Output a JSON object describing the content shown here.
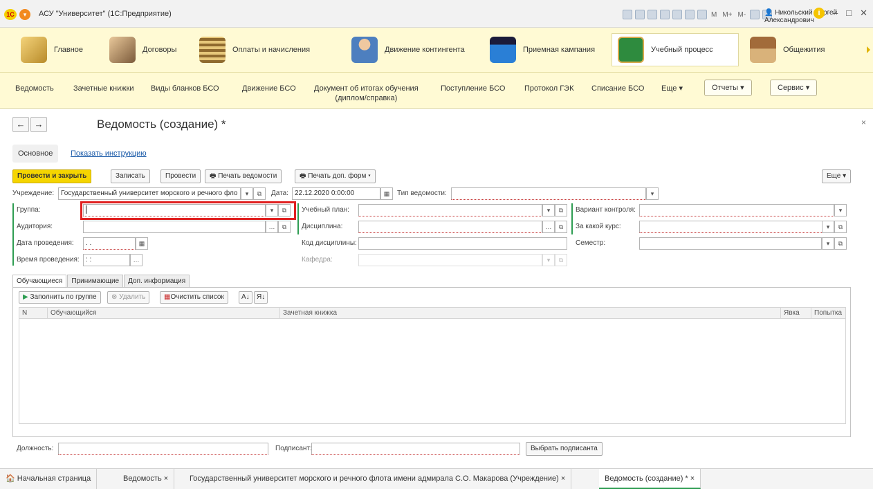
{
  "window": {
    "title": "АСУ \"Университет\" (1С:Предприятие)",
    "logo_text": "1С",
    "user": "Никольский Сергей Александрович",
    "toolbar_text": [
      "M",
      "M+",
      "M-"
    ],
    "info_label": "i",
    "minimize": "–",
    "maximize": "□",
    "close": "✕"
  },
  "sections": [
    {
      "label": "Главное",
      "icon": "desk-lamp-icon",
      "color": "#d8b14a"
    },
    {
      "label": "Договоры",
      "icon": "handshake-icon",
      "color": "#c8a06a"
    },
    {
      "label": "Оплаты и начисления",
      "icon": "abacus-icon",
      "color": "#8f6a2e"
    },
    {
      "label": "Движение контингента",
      "icon": "person-icon",
      "color": "#4d7fbf"
    },
    {
      "label": "Приемная кампания",
      "icon": "graduate-icon",
      "color": "#2a7fd6"
    },
    {
      "label": "Учебный процесс",
      "icon": "blackboard-icon",
      "color": "#2e8b3e"
    },
    {
      "label": "Общежития",
      "icon": "house-icon",
      "color": "#8b5a2b"
    }
  ],
  "subnav": {
    "items": [
      "Ведомость",
      "Зачетные книжки",
      "Виды бланков БСО",
      "Движение БСО",
      "Документ об итогах обучения",
      "Поступление БСО",
      "Протокол ГЭК",
      "Списание БСО"
    ],
    "item_doc_line2": "(диплом/справка)",
    "more": "Еще ▾",
    "reports": "Отчеты ▾",
    "service": "Сервис ▾"
  },
  "form": {
    "back": "←",
    "forward": "→",
    "title": "Ведомость (создание) *",
    "close": "×",
    "tabs": {
      "main": "Основное",
      "help": "Показать инструкцию"
    },
    "buttons": {
      "post_close": "Провести и закрыть",
      "save": "Записать",
      "post": "Провести",
      "print": "Печать ведомости",
      "print_extra": "Печать доп. форм ▾",
      "more": "Еще ▾"
    },
    "fields": {
      "institution_label": "Учреждение:",
      "institution_value": "Государственный университет морского и речного фло",
      "date_label": "Дата:",
      "date_value": "22.12.2020 0:00:00",
      "type_label": "Тип ведомости:",
      "type_value": "",
      "group_label": "Группа:",
      "group_value": "",
      "auditorium_label": "Аудитория:",
      "auditorium_value": "",
      "held_date_label": "Дата проведения:",
      "held_date_value": " . . ",
      "held_time_label": "Время проведения:",
      "held_time_value": " : : ",
      "plan_label": "Учебный план:",
      "plan_value": "",
      "discipline_label": "Дисциплина:",
      "discipline_value": "",
      "discipline_code_label": "Код дисциплины:",
      "discipline_code_value": "",
      "department_label": "Кафедра:",
      "department_value": "",
      "control_label": "Вариант контроля:",
      "control_value": "",
      "course_label": "За какой курс:",
      "course_value": "",
      "semester_label": "Семестр:",
      "semester_value": ""
    },
    "inner_tabs": [
      "Обучающиеся",
      "Принимающие",
      "Доп. информация"
    ],
    "table_buttons": {
      "fill": "Заполнить по группе",
      "delete": "Удалить",
      "clear": "Очистить список",
      "sort_asc": "А↓",
      "sort_desc": "Я↓"
    },
    "table_headers": [
      "N",
      "Обучающийся",
      "Зачетная книжка",
      "Явка",
      "Попытка"
    ],
    "bottom": {
      "position_label": "Должность:",
      "position_value": "",
      "signer_label": "Подписант:",
      "signer_value": "",
      "choose_signer": "Выбрать подписанта"
    }
  },
  "taskbar": {
    "items": [
      {
        "label": "Начальная страница",
        "icon": "home-icon"
      },
      {
        "label": "Ведомость ×"
      },
      {
        "label": "Государственный университет морского и речного флота имени адмирала С.О. Макарова (Учреждение) ×"
      },
      {
        "label": "Ведомость (создание) * ×"
      }
    ]
  },
  "colors": {
    "accent_yellow": "#f5d500",
    "section_bg": "#fffad4",
    "required_green": "#2e9d52",
    "highlight_red": "#e02020",
    "link_blue": "#1a5aa8"
  }
}
